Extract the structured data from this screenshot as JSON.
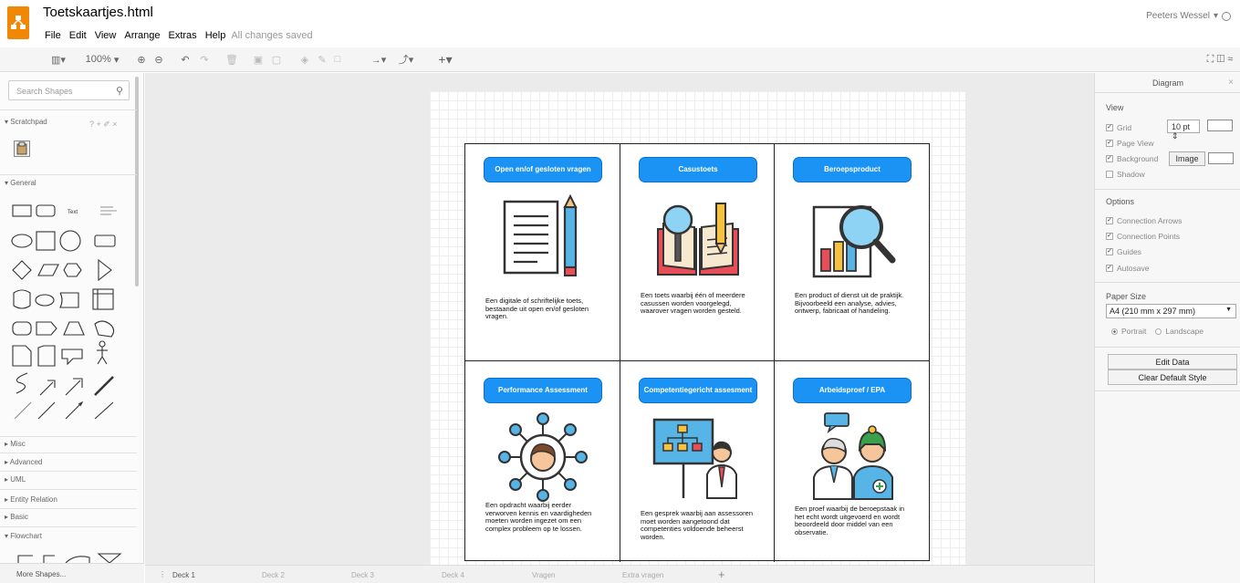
{
  "app": {
    "title": "Toetskaartjes.html",
    "menu": [
      "File",
      "Edit",
      "View",
      "Arrange",
      "Extras",
      "Help"
    ],
    "save_status": "All changes saved",
    "user": "Peeters Wessel"
  },
  "toolbar": {
    "zoom": "100%"
  },
  "sidebar": {
    "search_placeholder": "Search Shapes",
    "sections": {
      "scratchpad": "Scratchpad",
      "general": "General",
      "misc": "Misc",
      "advanced": "Advanced",
      "uml": "UML",
      "entity_relation": "Entity Relation",
      "basic": "Basic",
      "flowchart": "Flowchart"
    },
    "shape_text_label": "Text",
    "more_shapes": "More Shapes..."
  },
  "cards": [
    {
      "title": "Open en/of gesloten vragen",
      "text": "Een digitale of schriftelijke toets, bestaande uit open en/of gesloten vragen.",
      "icon": "document-pencil-icon"
    },
    {
      "title": "Casustoets",
      "text": "Een toets waarbij één of meerdere casussen worden voorgelegd, waarover vragen worden gesteld.",
      "icon": "book-magnifier-icon"
    },
    {
      "title": "Beroepsproduct",
      "text": "Een product of dienst uit de praktijk. Bijvoorbeeld een analyse, advies, ontwerp, fabricaat of handeling.",
      "icon": "chart-magnifier-icon"
    },
    {
      "title": "Performance Assessment",
      "text": "Een opdracht waarbij eerder verworven kennis en vaardigheden moeten worden ingezet om een complex probleem op te lossen.",
      "icon": "person-network-icon"
    },
    {
      "title": "Competentiegericht assesment",
      "text": "Een gesprek waarbij aan assessoren moet worden aangetoond dat competenties voldoende beheerst worden.",
      "icon": "presenter-board-icon"
    },
    {
      "title": "Arbeidsproef / EPA",
      "text": "Een proef waarbij de beroepstaak in het echt wordt uitgevoerd en wordt beoordeeld door middel van een observatie.",
      "icon": "doctor-nurse-icon"
    }
  ],
  "format_panel": {
    "header": "Diagram",
    "view_label": "View",
    "grid_label": "Grid",
    "grid_size": "10 pt",
    "page_view_label": "Page View",
    "background_label": "Background",
    "image_button": "Image",
    "shadow_label": "Shadow",
    "options_label": "Options",
    "options": [
      "Connection Arrows",
      "Connection Points",
      "Guides",
      "Autosave"
    ],
    "paper_size_label": "Paper Size",
    "paper_size_value": "A4 (210 mm x 297 mm)",
    "portrait_label": "Portrait",
    "landscape_label": "Landscape",
    "edit_data_button": "Edit Data",
    "clear_style_button": "Clear Default Style"
  },
  "tabs": [
    "Deck 1",
    "Deck 2",
    "Deck 3",
    "Deck 4",
    "Vragen",
    "Extra vragen"
  ],
  "colors": {
    "accent": "#1a93f5",
    "logo": "#f08705"
  }
}
